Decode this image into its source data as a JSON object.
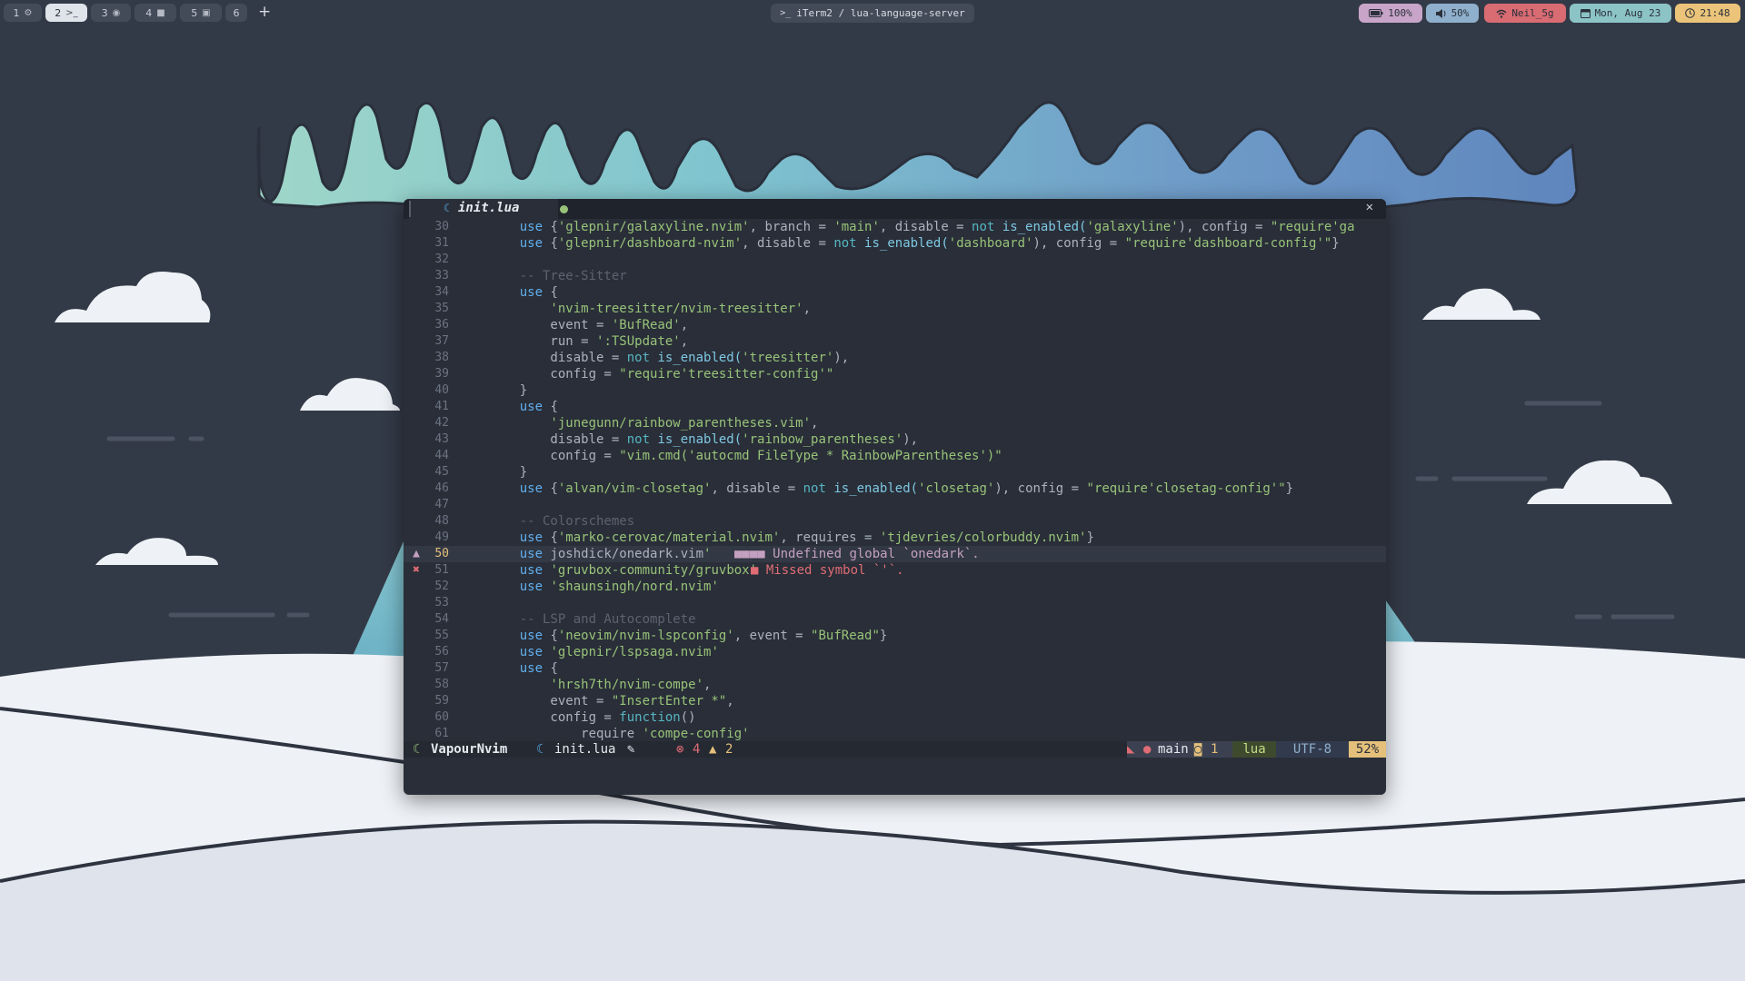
{
  "topbar": {
    "workspaces": [
      {
        "label": "1",
        "icon": "settings-icon",
        "glyph": "⚙"
      },
      {
        "label": "2",
        "icon": "terminal-icon",
        "glyph": ">_"
      },
      {
        "label": "3",
        "icon": "compass-icon",
        "glyph": "◉"
      },
      {
        "label": "4",
        "icon": "camera-icon",
        "glyph": "■"
      },
      {
        "label": "5",
        "icon": "chat-icon",
        "glyph": "▣"
      },
      {
        "label": "6",
        "icon": "",
        "glyph": ""
      }
    ],
    "add_label": "+",
    "window_title": "iTerm2 / lua-language-server",
    "battery": "100%",
    "volume": "50%",
    "wifi": "Neil_5g",
    "date": "Mon, Aug 23",
    "time": "21:48",
    "colors": {
      "battery": "#c8a5c8",
      "volume": "#8fb0cc",
      "wifi": "#d96b72",
      "date": "#8cc4c6",
      "time": "#ebc47a"
    }
  },
  "editor": {
    "tab_name": "init.lua",
    "close_label": "✕",
    "lines": [
      {
        "n": "30",
        "t": [
          [
            "    use {",
            "p"
          ],
          [
            "'glepnir/galaxyline.nvim'",
            "s"
          ],
          [
            ", branch = ",
            "p"
          ],
          [
            "'main'",
            "s"
          ],
          [
            ", disable = ",
            "p"
          ],
          [
            "not",
            "o"
          ],
          [
            " is_enabled(",
            "f"
          ],
          [
            "'galaxyline'",
            "s"
          ],
          [
            "), config = ",
            "p"
          ],
          [
            "\"require'ga",
            "s"
          ]
        ]
      },
      {
        "n": "31",
        "t": [
          [
            "    use {",
            "p"
          ],
          [
            "'glepnir/dashboard-nvim'",
            "s"
          ],
          [
            ", disable = ",
            "p"
          ],
          [
            "not",
            "o"
          ],
          [
            " is_enabled(",
            "f"
          ],
          [
            "'dashboard'",
            "s"
          ],
          [
            "), config = ",
            "p"
          ],
          [
            "\"require'dashboard-config'\"",
            "s"
          ],
          [
            "}",
            "p"
          ]
        ]
      },
      {
        "n": "32",
        "t": []
      },
      {
        "n": "33",
        "t": [
          [
            "    -- Tree-Sitter",
            "c"
          ]
        ]
      },
      {
        "n": "34",
        "t": [
          [
            "    use {",
            "p"
          ]
        ]
      },
      {
        "n": "35",
        "t": [
          [
            "        'nvim-treesitter/nvim-treesitter'",
            "s"
          ],
          [
            ",",
            "p"
          ]
        ]
      },
      {
        "n": "36",
        "t": [
          [
            "        event = ",
            "p"
          ],
          [
            "'BufRead'",
            "s"
          ],
          [
            ",",
            "p"
          ]
        ]
      },
      {
        "n": "37",
        "t": [
          [
            "        run = ",
            "p"
          ],
          [
            "':TSUpdate'",
            "s"
          ],
          [
            ",",
            "p"
          ]
        ]
      },
      {
        "n": "38",
        "t": [
          [
            "        disable = ",
            "p"
          ],
          [
            "not",
            "o"
          ],
          [
            " is_enabled(",
            "f"
          ],
          [
            "'treesitter'",
            "s"
          ],
          [
            "),",
            "p"
          ]
        ]
      },
      {
        "n": "39",
        "t": [
          [
            "        config = ",
            "p"
          ],
          [
            "\"require'treesitter-config'\"",
            "s"
          ]
        ]
      },
      {
        "n": "40",
        "t": [
          [
            "    }",
            "p"
          ]
        ]
      },
      {
        "n": "41",
        "t": [
          [
            "    use {",
            "p"
          ]
        ]
      },
      {
        "n": "42",
        "t": [
          [
            "        'junegunn/rainbow_parentheses.vim'",
            "s"
          ],
          [
            ",",
            "p"
          ]
        ]
      },
      {
        "n": "43",
        "t": [
          [
            "        disable = ",
            "p"
          ],
          [
            "not",
            "o"
          ],
          [
            " is_enabled(",
            "f"
          ],
          [
            "'rainbow_parentheses'",
            "s"
          ],
          [
            "),",
            "p"
          ]
        ]
      },
      {
        "n": "44",
        "t": [
          [
            "        config = ",
            "p"
          ],
          [
            "\"vim.cmd('autocmd FileType * RainbowParentheses')\"",
            "s"
          ]
        ]
      },
      {
        "n": "45",
        "t": [
          [
            "    }",
            "p"
          ]
        ]
      },
      {
        "n": "46",
        "t": [
          [
            "    use {",
            "p"
          ],
          [
            "'alvan/vim-closetag'",
            "s"
          ],
          [
            ", disable = ",
            "p"
          ],
          [
            "not",
            "o"
          ],
          [
            " is_enabled(",
            "f"
          ],
          [
            "'closetag'",
            "s"
          ],
          [
            "), config = ",
            "p"
          ],
          [
            "\"require'closetag-config'\"",
            "s"
          ],
          [
            "}",
            "p"
          ]
        ]
      },
      {
        "n": "47",
        "t": []
      },
      {
        "n": "48",
        "t": [
          [
            "    -- Colorschemes",
            "c"
          ]
        ]
      },
      {
        "n": "49",
        "t": [
          [
            "    use {",
            "p"
          ],
          [
            "'marko-cerovac/material.nvim'",
            "s"
          ],
          [
            ", requires = ",
            "p"
          ],
          [
            "'tjdevries/colorbuddy.nvim'",
            "s"
          ],
          [
            "}",
            "p"
          ]
        ]
      },
      {
        "n": "50",
        "t": [
          [
            "    use ",
            "p"
          ],
          [
            "joshdick/onedark.vim",
            "p"
          ],
          [
            "'",
            "s"
          ]
        ],
        "current": true,
        "sign": "▲",
        "signColor": "#c4a0c0"
      },
      {
        "n": "51",
        "t": [
          [
            "    use ",
            "p"
          ],
          [
            "'gruvbox-community/gruvbox'",
            "s"
          ]
        ],
        "sign": "✖",
        "signColor": "#e06c75"
      },
      {
        "n": "52",
        "t": [
          [
            "    use ",
            "p"
          ],
          [
            "'shaunsingh/nord.nvim'",
            "s"
          ]
        ]
      },
      {
        "n": "53",
        "t": []
      },
      {
        "n": "54",
        "t": [
          [
            "    -- LSP and Autocomplete",
            "c"
          ]
        ]
      },
      {
        "n": "55",
        "t": [
          [
            "    use {",
            "p"
          ],
          [
            "'neovim/nvim-lspconfig'",
            "s"
          ],
          [
            ", event = ",
            "p"
          ],
          [
            "\"BufRead\"",
            "s"
          ],
          [
            "}",
            "p"
          ]
        ]
      },
      {
        "n": "56",
        "t": [
          [
            "    use ",
            "p"
          ],
          [
            "'glepnir/lspsaga.nvim'",
            "s"
          ]
        ]
      },
      {
        "n": "57",
        "t": [
          [
            "    use {",
            "p"
          ]
        ]
      },
      {
        "n": "58",
        "t": [
          [
            "        'hrsh7th/nvim-compe'",
            "s"
          ],
          [
            ",",
            "p"
          ]
        ]
      },
      {
        "n": "59",
        "t": [
          [
            "        event = ",
            "p"
          ],
          [
            "\"InsertEnter *\"",
            "s"
          ],
          [
            ",",
            "p"
          ]
        ]
      },
      {
        "n": "60",
        "t": [
          [
            "        config = ",
            "p"
          ],
          [
            "function",
            "o"
          ],
          [
            "()",
            "p"
          ]
        ]
      },
      {
        "n": "61",
        "t": [
          [
            "            require ",
            "p"
          ],
          [
            "'compe-config'",
            "s"
          ]
        ]
      }
    ],
    "diagnostics": [
      {
        "line_index": 20,
        "text": "Undefined global `onedark`.",
        "color": "#c4a0c0"
      },
      {
        "line_index": 21,
        "text": "Missed symbol `'`.",
        "color": "#e06c75"
      }
    ]
  },
  "statusline": {
    "mode": "VapourNvim",
    "file": "init.lua",
    "errors": "4",
    "warnings": "2",
    "branch": "main",
    "branch_count": "1",
    "filetype": "lua",
    "encoding": "UTF-8",
    "percent": "52%"
  }
}
